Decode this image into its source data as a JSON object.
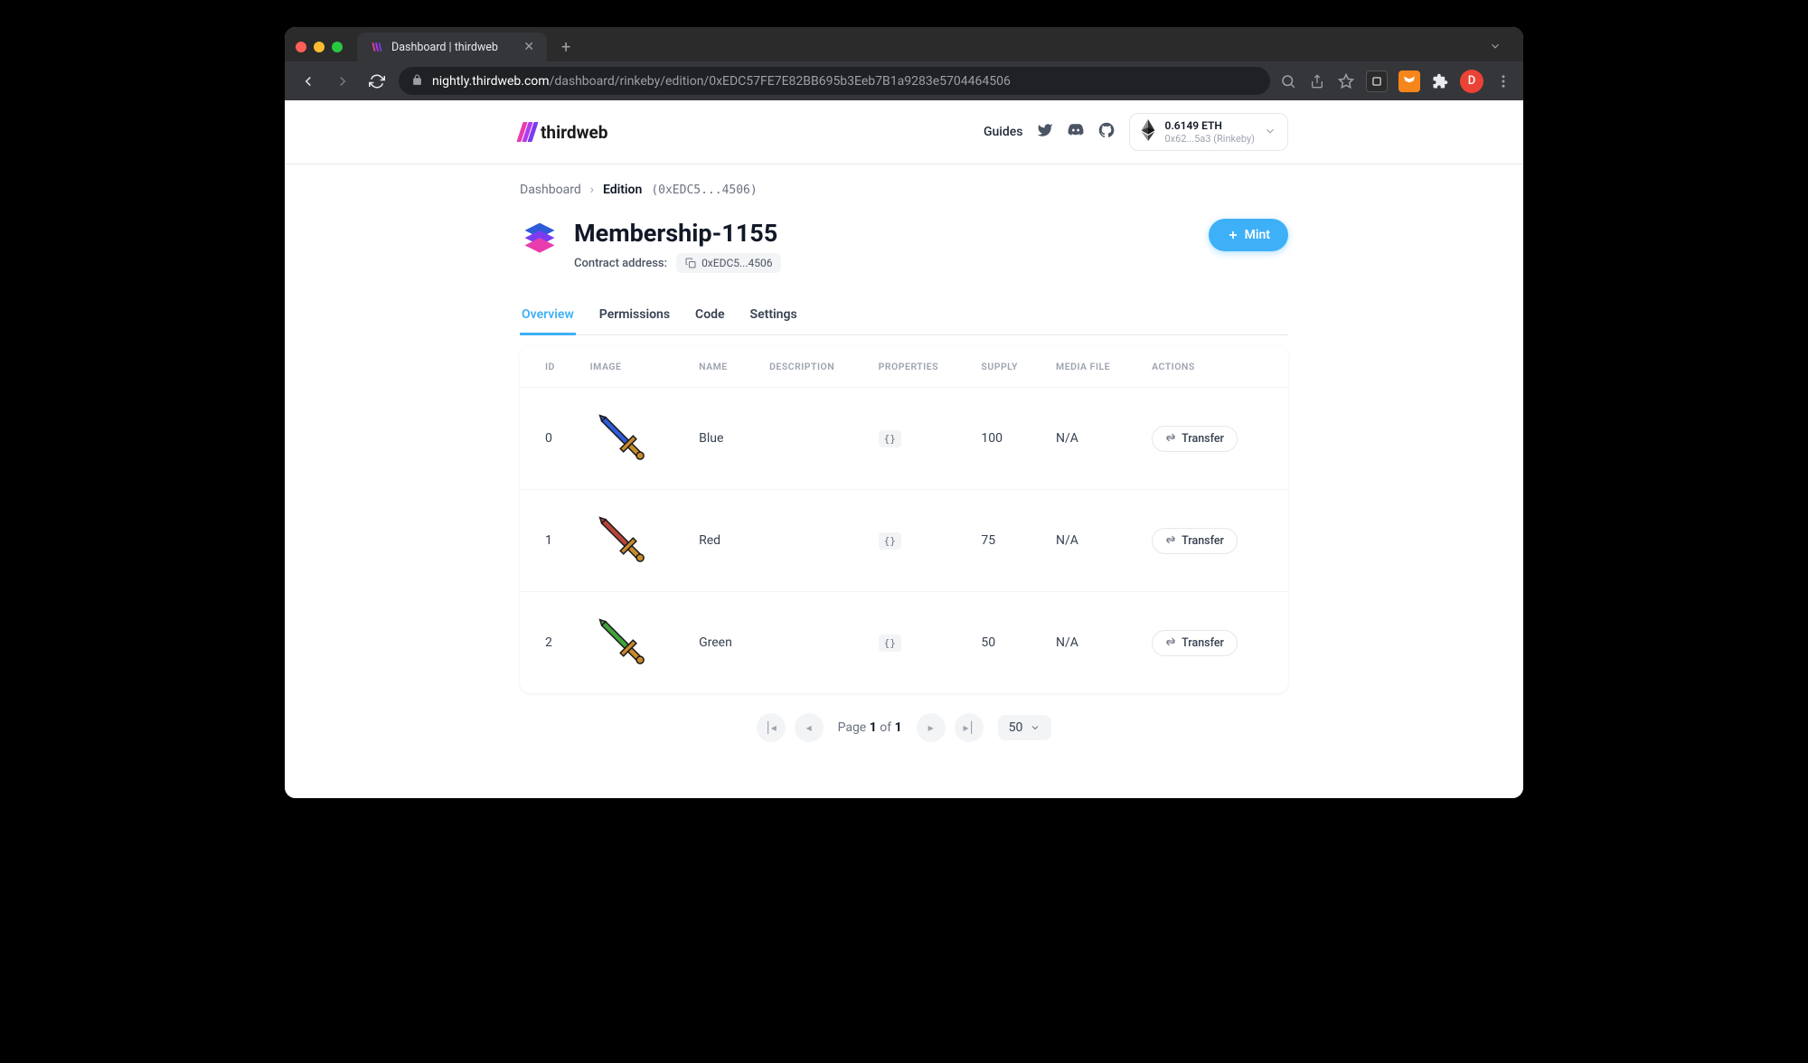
{
  "browser": {
    "tab_title": "Dashboard | thirdweb",
    "url_domain": "nightly.thirdweb.com",
    "url_path": "/dashboard/rinkeby/edition/0xEDC57FE7E82BB695b3Eeb7B1a9283e5704464506",
    "avatar_letter": "D"
  },
  "topbar": {
    "brand": "thirdweb",
    "guides": "Guides",
    "wallet_balance": "0.6149 ETH",
    "wallet_address": "0x62...5a3 (Rinkeby)"
  },
  "breadcrumb": {
    "root": "Dashboard",
    "current": "Edition",
    "hash": "(0xEDC5...4506)"
  },
  "header": {
    "title": "Membership-1155",
    "address_label": "Contract address:",
    "address_short": "0xEDC5...4506",
    "mint_label": "Mint"
  },
  "tabs": {
    "overview": "Overview",
    "permissions": "Permissions",
    "code": "Code",
    "settings": "Settings"
  },
  "table": {
    "columns": {
      "id": "ID",
      "image": "IMAGE",
      "name": "NAME",
      "description": "DESCRIPTION",
      "properties": "PROPERTIES",
      "supply": "SUPPLY",
      "media": "MEDIA FILE",
      "actions": "ACTIONS"
    },
    "props_badge": "{}",
    "transfer_label": "Transfer",
    "rows": [
      {
        "id": "0",
        "name": "Blue",
        "supply": "100",
        "media": "N/A",
        "color_blade": "#2e5bd8",
        "color_hilt": "#c98a2b"
      },
      {
        "id": "1",
        "name": "Red",
        "supply": "75",
        "media": "N/A",
        "color_blade": "#b8443a",
        "color_hilt": "#c98a2b"
      },
      {
        "id": "2",
        "name": "Green",
        "supply": "50",
        "media": "N/A",
        "color_blade": "#3fa23a",
        "color_hilt": "#c98a2b"
      }
    ]
  },
  "pagination": {
    "page_word": "Page",
    "current": "1",
    "of_word": "of",
    "total": "1",
    "page_size": "50"
  }
}
